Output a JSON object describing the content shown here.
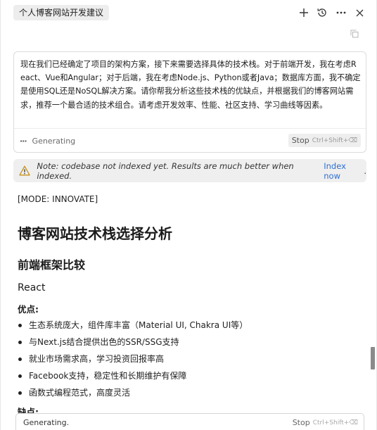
{
  "header": {
    "chat_title": "个人博客网站开发建议",
    "icons": [
      "plus-icon",
      "history-icon",
      "more-icon",
      "close-icon"
    ]
  },
  "prompt": {
    "text": "现在我们已经确定了项目的架构方案，接下来需要选择具体的技术栈。对于前端开发，我在考虑React、Vue和Angular；对于后端，我在考虑Node.js、Python或者Java；数据库方面，我不确定是使用SQL还是NoSQL解决方案。请你帮我分析这些技术栈的优缺点，并根据我们的博客网站需求，推荐一个最合适的技术组合。请考虑开发效率、性能、社区支持、学习曲线等因素。",
    "status": "Generating",
    "stop_label": "Stop",
    "stop_shortcut": "Ctrl+Shift+⌫"
  },
  "notice": {
    "text": "Note: codebase not indexed yet. Results are much better when indexed.",
    "link": "Index now",
    "suffix": "."
  },
  "response": {
    "mode": "[MODE: INNOVATE]",
    "title": "博客网站技术栈选择分析",
    "section": "前端框架比较",
    "framework": "React",
    "pros_label": "优点:",
    "pros": [
      "生态系统庞大，组件库丰富（Material UI, Chakra UI等）",
      "与Next.js结合提供出色的SSR/SSG支持",
      "就业市场需求高，学习投资回报率高",
      "Facebook支持，稳定性和长期维护有保障",
      "函数式编程范式，高度灵活"
    ],
    "cons_label": "缺点:"
  },
  "bottom": {
    "status": "Generating.",
    "stop_label": "Stop",
    "stop_shortcut": "Ctrl+Shift+⌫"
  }
}
